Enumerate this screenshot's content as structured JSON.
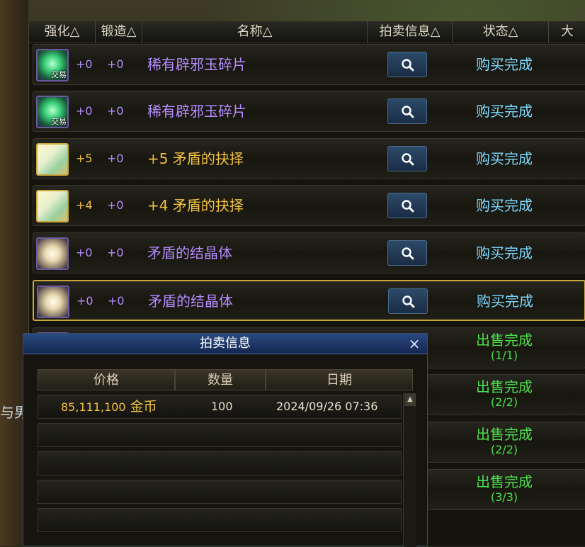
{
  "table": {
    "columns": {
      "enhance": "强化△",
      "forge": "锻造△",
      "name": "名称△",
      "auction_info": "拍卖信息△",
      "status": "状态△",
      "extra": "大"
    },
    "rows": [
      {
        "icon": "jade-fragment-icon",
        "icon_tag": "交易",
        "enhance": "+0",
        "forge": "+0",
        "name": "稀有辟邪玉碎片",
        "name_color": "purple",
        "status": "购买完成",
        "status_count": ""
      },
      {
        "icon": "jade-fragment-icon",
        "icon_tag": "交易",
        "enhance": "+0",
        "forge": "+0",
        "name": "稀有辟邪玉碎片",
        "name_color": "purple",
        "status": "购买完成",
        "status_count": ""
      },
      {
        "icon": "scroll-item-icon",
        "icon_tag": "",
        "enhance": "+5",
        "forge": "+0",
        "name": "+5 矛盾的抉择",
        "name_color": "gold",
        "status": "购买完成",
        "status_count": ""
      },
      {
        "icon": "scroll-item-icon",
        "icon_tag": "",
        "enhance": "+4",
        "forge": "+0",
        "name": "+4 矛盾的抉择",
        "name_color": "gold",
        "status": "购买完成",
        "status_count": ""
      },
      {
        "icon": "crystal-item-icon",
        "icon_tag": "",
        "enhance": "+0",
        "forge": "+0",
        "name": "矛盾的结晶体",
        "name_color": "purple",
        "status": "购买完成",
        "status_count": ""
      },
      {
        "icon": "crystal-item-icon",
        "icon_tag": "",
        "enhance": "+0",
        "forge": "+0",
        "name": "矛盾的结晶体",
        "name_color": "purple",
        "status": "购买完成",
        "status_count": ""
      },
      {
        "icon": "jade-fragment-icon",
        "icon_tag": "交易",
        "enhance": "",
        "forge": "",
        "name": "",
        "name_color": "purple",
        "status": "出售完成",
        "status_count": "(1/1)"
      },
      {
        "icon": "",
        "icon_tag": "",
        "enhance": "",
        "forge": "",
        "name": "",
        "name_color": "purple",
        "status": "出售完成",
        "status_count": "(2/2)"
      },
      {
        "icon": "",
        "icon_tag": "",
        "enhance": "",
        "forge": "",
        "name": "",
        "name_color": "purple",
        "status": "出售完成",
        "status_count": "(2/2)"
      },
      {
        "icon": "",
        "icon_tag": "",
        "enhance": "",
        "forge": "",
        "name": "",
        "name_color": "purple",
        "status": "出售完成",
        "status_count": "(3/3)"
      }
    ]
  },
  "popup": {
    "title": "拍卖信息",
    "close_symbol": "×",
    "columns": {
      "price": "价格",
      "quantity": "数量",
      "date": "日期"
    },
    "rows": [
      {
        "price": "85,111,100",
        "currency": "金币",
        "quantity": "100",
        "date": "2024/09/26 07:36"
      }
    ],
    "empty_rows": 4
  },
  "background": {
    "left_text": "与男"
  },
  "colors": {
    "purple_text": "#b48cff",
    "gold_text": "#f0c040",
    "bought_status": "#7fd8ff",
    "sold_status": "#4ce04c",
    "selected_border": "#c9a83c"
  }
}
